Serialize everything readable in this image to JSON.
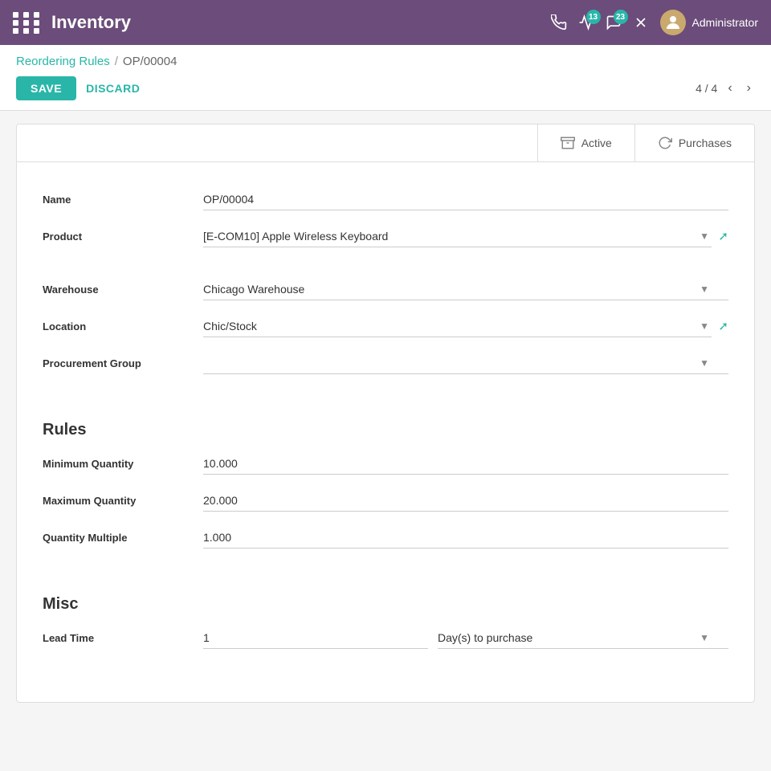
{
  "topnav": {
    "title": "Inventory",
    "icons": {
      "phone": "📞",
      "activity_badge": "13",
      "chat_badge": "23"
    },
    "admin_label": "Administrator"
  },
  "breadcrumb": {
    "parent": "Reordering Rules",
    "separator": "/",
    "current": "OP/00004"
  },
  "toolbar": {
    "save_label": "SAVE",
    "discard_label": "DISCARD",
    "pager_current": "4",
    "pager_total": "4"
  },
  "tabs": [
    {
      "id": "active",
      "label": "Active",
      "icon": "archive"
    },
    {
      "id": "purchases",
      "label": "Purchases",
      "icon": "refresh"
    }
  ],
  "form": {
    "name_label": "Name",
    "name_value": "OP/00004",
    "product_label": "Product",
    "product_value": "[E-COM10] Apple Wireless Keyboard",
    "warehouse_label": "Warehouse",
    "warehouse_value": "Chicago Warehouse",
    "location_label": "Location",
    "location_value": "Chic/Stock",
    "procurement_group_label": "Procurement Group",
    "procurement_group_value": "",
    "rules_section": "Rules",
    "min_qty_label": "Minimum Quantity",
    "min_qty_value": "10.000",
    "max_qty_label": "Maximum Quantity",
    "max_qty_value": "20.000",
    "qty_multiple_label": "Quantity Multiple",
    "qty_multiple_value": "1.000",
    "misc_section": "Misc",
    "lead_time_label": "Lead Time",
    "lead_time_value": "1",
    "lead_time_unit": "Day(s) to purchase"
  }
}
